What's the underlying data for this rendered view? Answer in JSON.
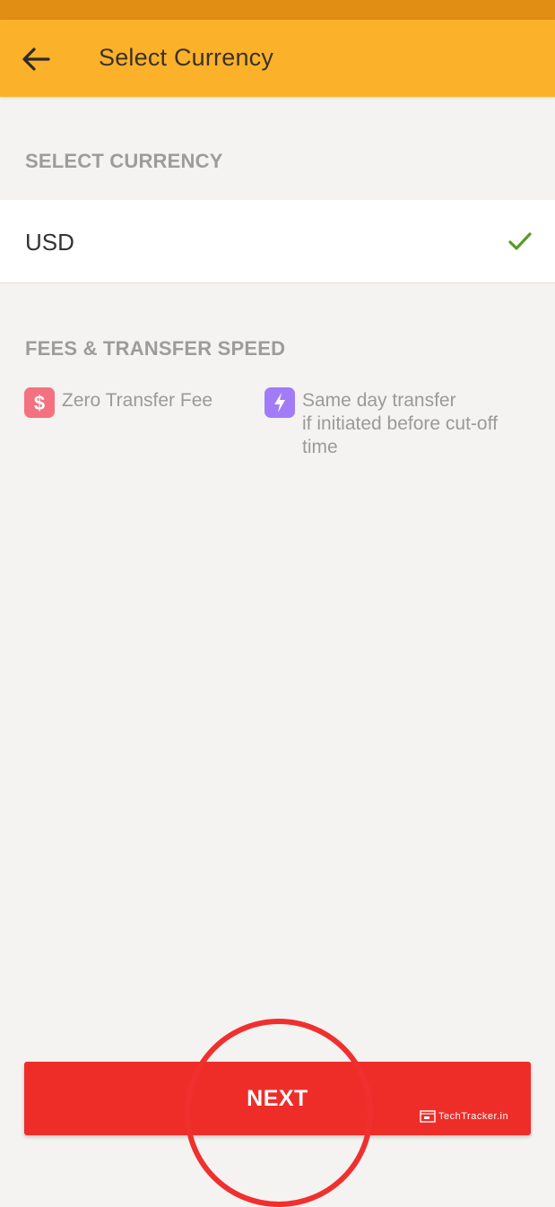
{
  "app_bar": {
    "title": "Select Currency",
    "back_icon": "arrow-left-icon",
    "color": "#fcb12a",
    "status_bar_color": "#e08e14"
  },
  "currency_section": {
    "heading": "SELECT CURRENCY",
    "selected_currency": "USD",
    "selected_icon": "checkmark-icon",
    "check_color": "#5a9a28"
  },
  "fees_section": {
    "heading": "FEES & TRANSFER SPEED",
    "features": [
      {
        "icon": "dollar-icon",
        "icon_color": "#f4717f",
        "text": "Zero Transfer Fee"
      },
      {
        "icon": "lightning-icon",
        "icon_color": "#a27cf6",
        "line1": "Same day transfer",
        "line2": "if initiated before cut-off",
        "line3": "time"
      }
    ]
  },
  "next_button": {
    "label": "NEXT",
    "color": "#ee2d29"
  },
  "watermark": {
    "text": "TechTracker.in"
  }
}
